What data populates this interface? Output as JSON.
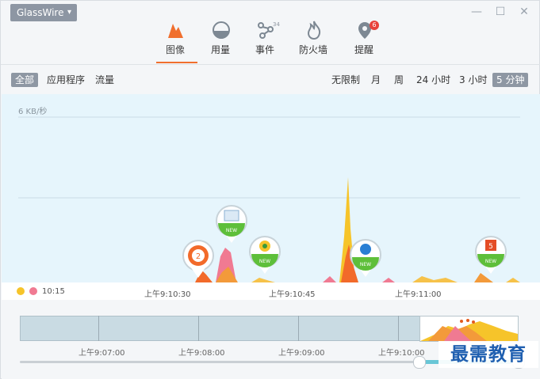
{
  "app": {
    "name": "GlassWire"
  },
  "tabs": [
    {
      "label": "图像",
      "icon": "graph-icon",
      "active": true
    },
    {
      "label": "用量",
      "icon": "usage-icon"
    },
    {
      "label": "事件",
      "icon": "events-icon",
      "badge_text": "34"
    },
    {
      "label": "防火墙",
      "icon": "firewall-icon"
    },
    {
      "label": "提醒",
      "icon": "alerts-icon",
      "badge_count": "6"
    }
  ],
  "filters": {
    "left": [
      "全部",
      "应用程序",
      "流量"
    ],
    "selected_left": "全部"
  },
  "ranges": {
    "items": [
      "无限制",
      "月",
      "周",
      "24 小时",
      "3 小时",
      "5 分钟"
    ],
    "selected": "5 分钟"
  },
  "graph": {
    "y_label": "6 KB/秒",
    "time_labels": [
      "上午9:10:30",
      "上午9:10:45",
      "上午9:11:00"
    ],
    "start_time": "10:15",
    "app_markers": [
      {
        "icon": "orange-app-icon",
        "badge": "2"
      },
      {
        "icon": "window-app-icon",
        "badge": "NEW"
      },
      {
        "icon": "chrome-like-app-icon",
        "badge": "NEW"
      },
      {
        "icon": "blue-app-icon",
        "badge": "NEW"
      },
      {
        "icon": "html5-app-icon",
        "badge": "NEW"
      }
    ]
  },
  "overview": {
    "time_labels": [
      "上午9:07:00",
      "上午9:08:00",
      "上午9:09:00",
      "上午9:10:00"
    ]
  },
  "colors": {
    "accent": "#f06f2e",
    "chart_bg": "#e6f5fc",
    "badge_red": "#e8423c",
    "selected_pill": "#8e97a3"
  },
  "watermark": "最需教育"
}
